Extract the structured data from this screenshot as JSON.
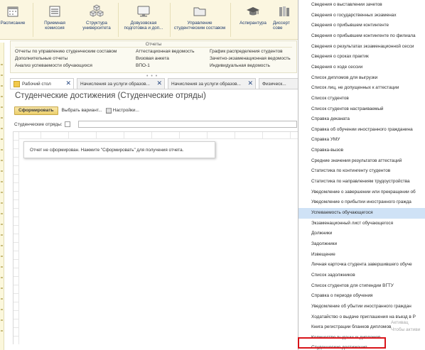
{
  "toolbar": {
    "items": [
      {
        "label": "Расписание",
        "icon": "calendar-icon"
      },
      {
        "label": "Приемная\nкомиссия",
        "icon": "list-icon"
      },
      {
        "label": "Структура\nуниверситета",
        "icon": "cubes-icon"
      },
      {
        "label": "Довузовская\nподготовка и доп...",
        "icon": "monitor-icon"
      },
      {
        "label": "Управление\nстудентческим составом",
        "icon": "folder-icon"
      },
      {
        "label": "Аспирантура",
        "icon": "graduation-cap-icon"
      },
      {
        "label": "Диссерт\nсове",
        "icon": "books-icon"
      }
    ]
  },
  "reports": {
    "title": "Отчеты",
    "col1": [
      "Отчеты по управлению студенческим составом",
      "Дополнительные отчеты",
      "Анализ успеваемости обучающихся"
    ],
    "col2": [
      "Аттестационная ведомость",
      "Визовая анкета",
      "ВПО-1"
    ],
    "col3": [
      "График распределения студентов",
      "Зачетно-экзаменационная ведомость",
      "Индивидуальная ведомость"
    ]
  },
  "tabs": [
    {
      "label": "Рабочий стол"
    },
    {
      "label": "Начисления за услуги образов..."
    },
    {
      "label": "Начисления за услуги образов..."
    },
    {
      "label": "Физическ..."
    }
  ],
  "form": {
    "title": "Студенческие достижения (Студенческие отряды)",
    "generate_label": "Сформировать",
    "variant_label": "Выбрать вариант...",
    "settings_label": "Настройки...",
    "filter_label": "Студенческие отряды:",
    "report_message": "Отчет не сформирован. Нажмите \"Сформировать\" для получения отчета."
  },
  "menu": {
    "items": [
      "Сведения о выставлении зачетов",
      "Сведения о государственных экзаменах",
      "Сведения о прибывшем контингенте",
      "Сведения о прибывшем контингенте по филиала",
      "Сведения о результатах экзаменационной сесси",
      "Сведения о сроках практик",
      "Сведения о ходе сессии",
      "Список дипломов для выгрузки",
      "Список лиц, не допущенных к аттестации",
      "Список студентов",
      "Список студентов настраиваемый",
      "Справка деканата",
      "Справка об обучении иностранного гражданина",
      "Справка УМУ",
      "Справка-вызов",
      "Средние значения результатов аттестаций",
      "Статистика по контингенту студентов",
      "Статистика по направлениям трудоустройства",
      "Уведомление о завершении или прекращении об",
      "Уведомление о прибытии иностранного гражда",
      "Успеваемость обучающегося",
      "Экзаменационный лист обучающегося",
      "Должники",
      "Задолжники",
      "Извещение",
      "Личная карточка студента завершившего обуче",
      "Список задолжников",
      "Список студентов для стипендии ВГТУ",
      "Справка о периоде обучения",
      "Уведомление об убытии иностранного граждан",
      "Ходатайство о выдаче приглашения на въезд в Р",
      "Книга регистрации бланков дипломов",
      "Количество выданных дипломов",
      "Студенческие достижения"
    ],
    "selected_index": 20,
    "highlighted_index": 33
  },
  "watermark": {
    "line1": "Активац",
    "line2": "Чтобы активи"
  },
  "colors": {
    "toolbar_bg": "#fbf6e0",
    "accent_button": "#eccf6b",
    "selected_row": "#cfe2f6",
    "highlight_box": "#d8141a",
    "toolbar_text": "#1e3a6e"
  }
}
